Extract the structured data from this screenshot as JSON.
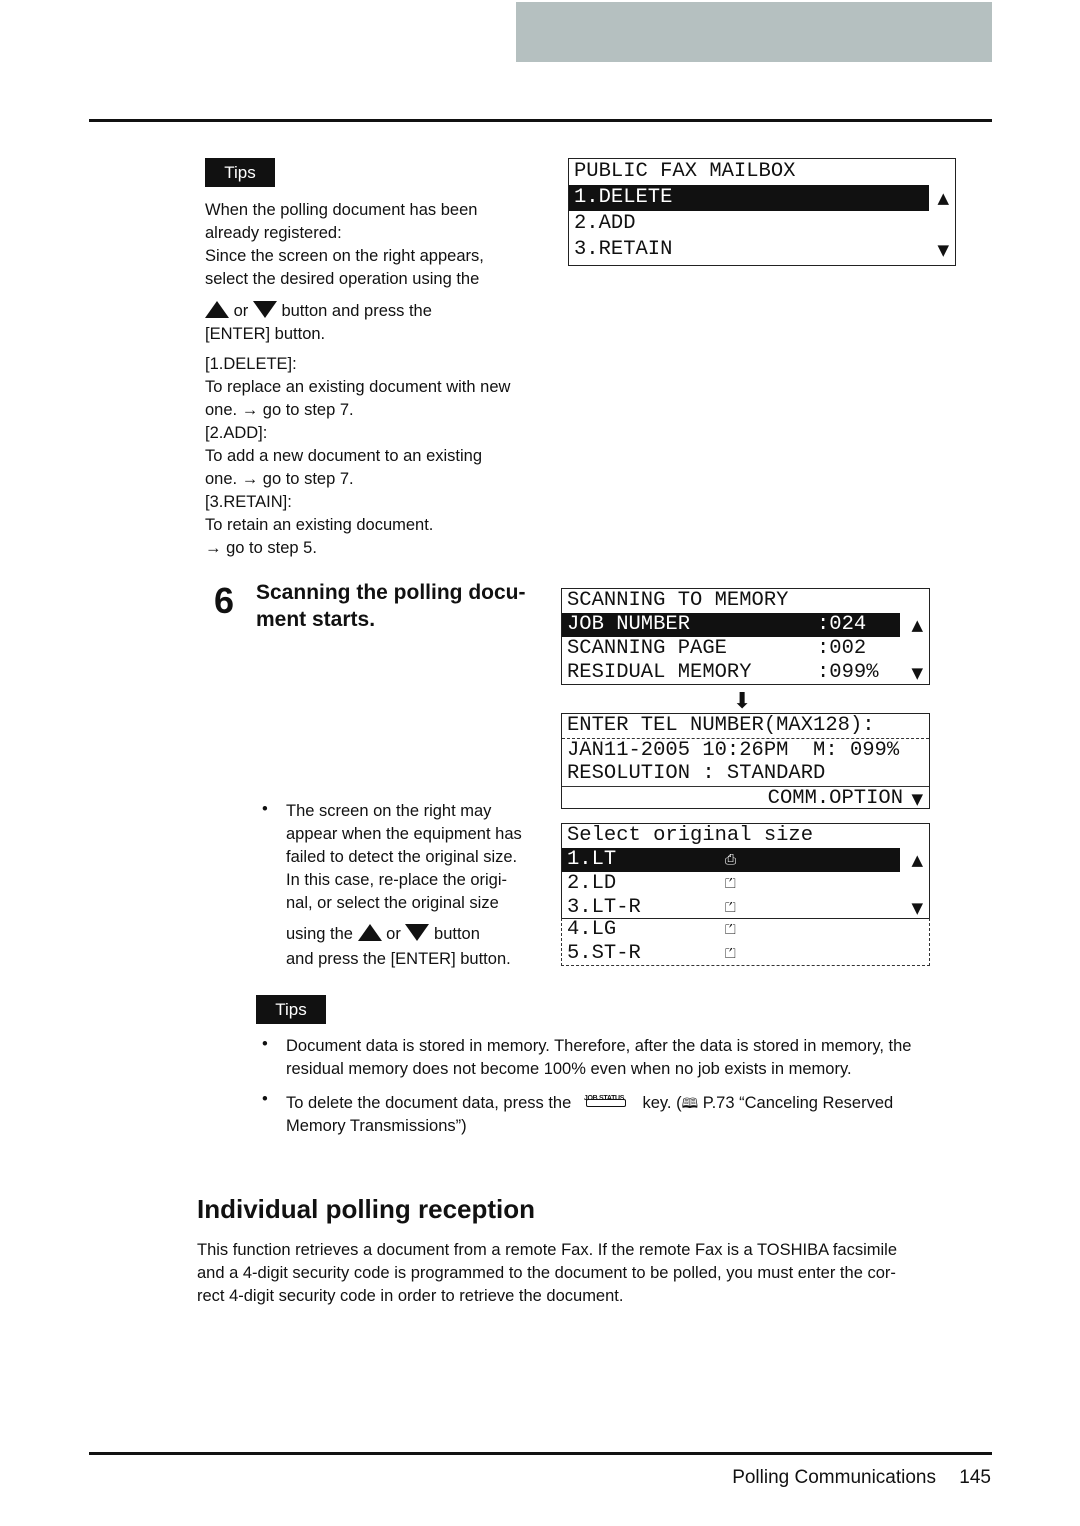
{
  "tips1": {
    "label": "Tips",
    "lines": [
      "When the polling document has been",
      "already registered:",
      "Since the screen on the right appears,",
      "select the desired operation using the"
    ],
    "button_line": [
      "or",
      "button and press the"
    ],
    "enter_line": "[ENTER] button.",
    "options": [
      "[1.DELETE]:",
      "To replace an existing document with new",
      "one. → go to step 7.",
      "[2.ADD]:",
      "To add a new document to an existing",
      "one. → go to step 7.",
      "[3.RETAIN]:",
      "To retain an existing document.",
      "→ go to step 5."
    ]
  },
  "lcd_mailbox": {
    "title": "PUBLIC FAX MAILBOX",
    "items": [
      "1.DELETE",
      "2.ADD",
      "3.RETAIN"
    ]
  },
  "step6": {
    "number": "6",
    "title_lines": [
      "Scanning the polling docu-",
      "ment starts."
    ]
  },
  "lcd_scanning": {
    "title": "SCANNING TO MEMORY",
    "rows": [
      {
        "label": "JOB NUMBER",
        "value": ":024"
      },
      {
        "label": "SCANNING PAGE",
        "value": ":002"
      },
      {
        "label": "RESIDUAL MEMORY",
        "value": ":099%"
      }
    ]
  },
  "lcd_ready": {
    "rows": [
      "ENTER TEL NUMBER(MAX128):",
      "JAN11-2005 10:26PM  M: 099%",
      "RESOLUTION : STANDARD"
    ],
    "option": "COMM.OPTION"
  },
  "lcd_size": {
    "title": "Select original size",
    "items": [
      "1.LT",
      "2.LD",
      "3.LT-R",
      "4.LG",
      "5.ST-R"
    ]
  },
  "note": {
    "lines": [
      "The screen on the right may",
      "appear when the equipment has",
      "failed to detect the original size.",
      "In this case, re-place the origi-",
      "nal, or select the original size"
    ],
    "using": "using the",
    "or": "or",
    "button": "button",
    "last": "and press the [ENTER] button."
  },
  "tips2": {
    "label": "Tips",
    "bullet1": [
      "Document data is stored in memory. Therefore, after the data is stored in memory, the",
      "residual memory does not become 100% even when no job exists in memory."
    ],
    "bullet2_pre": "To delete the document data, press the",
    "key_label": "JOB STATUS",
    "bullet2_post": "key. (",
    "ref": "P.73 “Canceling Reserved",
    "bullet2_line2": "Memory Transmissions”)"
  },
  "section": {
    "heading": "Individual polling reception",
    "para": [
      "This function retrieves a document from a remote Fax. If the remote Fax is a TOSHIBA facsimile",
      "and a 4-digit security code is programmed to the document to be polled, you must enter the cor-",
      "rect 4-digit security code in order to retrieve the document."
    ]
  },
  "footer": {
    "title": "Polling Communications",
    "page": "145"
  }
}
